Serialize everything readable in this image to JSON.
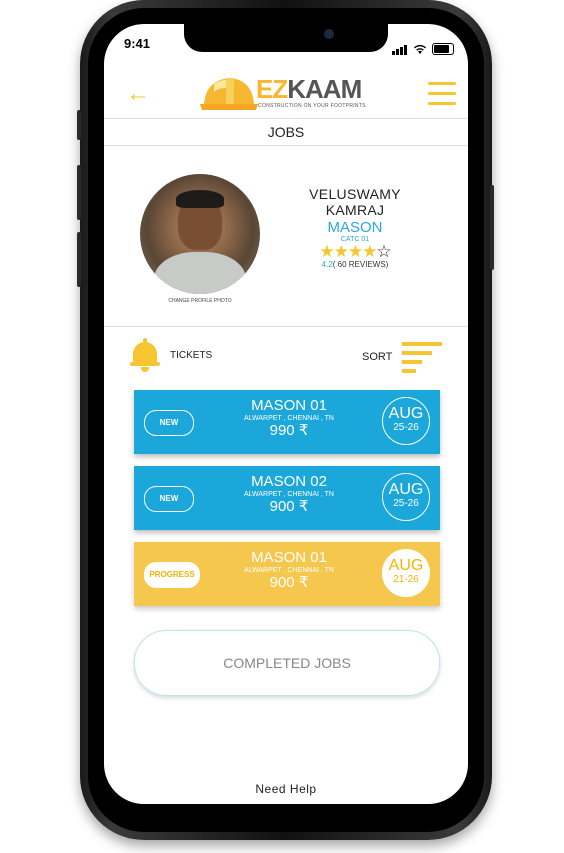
{
  "status_bar": {
    "time": "9:41"
  },
  "header": {
    "logo_text_ez": "EZ",
    "logo_text_kaam": "KAAM",
    "logo_tagline": "CONSTRUCTION ON YOUR FOOTPRINTS",
    "icons": {
      "back": "arrow-left-icon",
      "menu": "hamburger-menu-icon"
    }
  },
  "page_title": "JOBS",
  "profile": {
    "change_photo_label": "CHANGE PROFILE PHOTO",
    "name": "VELUSWAMY KAMRAJ",
    "role": "MASON",
    "code": "CATC 01",
    "rating_stars": 4,
    "rating_max": 5,
    "rating_value": "4.2",
    "reviews_text": "( 60 REVIEWS)"
  },
  "toolbar": {
    "tickets_label": "TICKETS",
    "sort_label": "SORT"
  },
  "jobs": [
    {
      "status": "NEW",
      "title": "MASON 01",
      "location": "ALWARPET , CHENNAI , TN",
      "price": "990 ₹",
      "month": "AUG",
      "days": "25-26"
    },
    {
      "status": "NEW",
      "title": "MASON 02",
      "location": "ALWARPET , CHENNAI , TN",
      "price": "900 ₹",
      "month": "AUG",
      "days": "25-26"
    },
    {
      "status": "PROGRESS",
      "title": "MASON 01",
      "location": "ALWARPET , CHENNAI , TN",
      "price": "900 ₹",
      "month": "AUG",
      "days": "21-26"
    }
  ],
  "completed_jobs_label": "COMPLETED JOBS",
  "need_help_label": "Need Help",
  "colors": {
    "accent_yellow": "#f7c531",
    "accent_blue": "#1ba7da"
  }
}
